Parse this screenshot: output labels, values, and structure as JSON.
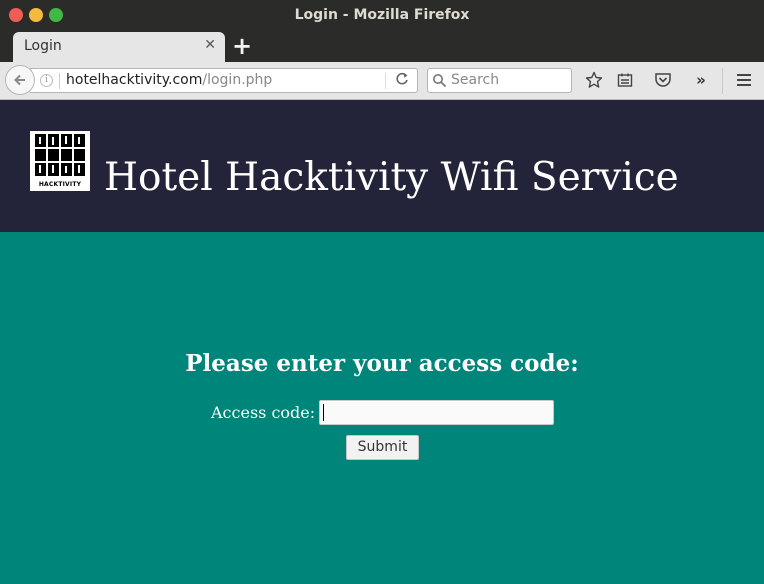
{
  "window": {
    "title": "Login - Mozilla Firefox",
    "controls": [
      "close",
      "minimize",
      "maximize"
    ]
  },
  "tabs": [
    {
      "label": "Login",
      "active": true
    }
  ],
  "navbar": {
    "url_host": "hotelhacktivity.com",
    "url_path": "/login.php",
    "search_placeholder": "Search",
    "overflow_label": "»",
    "icons": [
      "back-arrow-icon",
      "info-icon",
      "reload-icon",
      "search-icon",
      "star-icon",
      "reading-list-icon",
      "pocket-icon",
      "menu-icon"
    ]
  },
  "header": {
    "logo_text": "HACKTIVITY",
    "title": "Hotel Hacktivity Wifi Service",
    "background": "#23233a"
  },
  "login": {
    "heading": "Please enter your access code:",
    "label": "Access code:",
    "value": "",
    "submit_label": "Submit"
  },
  "colors": {
    "page_background": "#00857a",
    "header_background": "#23233a",
    "titlebar": "#2b2b29"
  }
}
